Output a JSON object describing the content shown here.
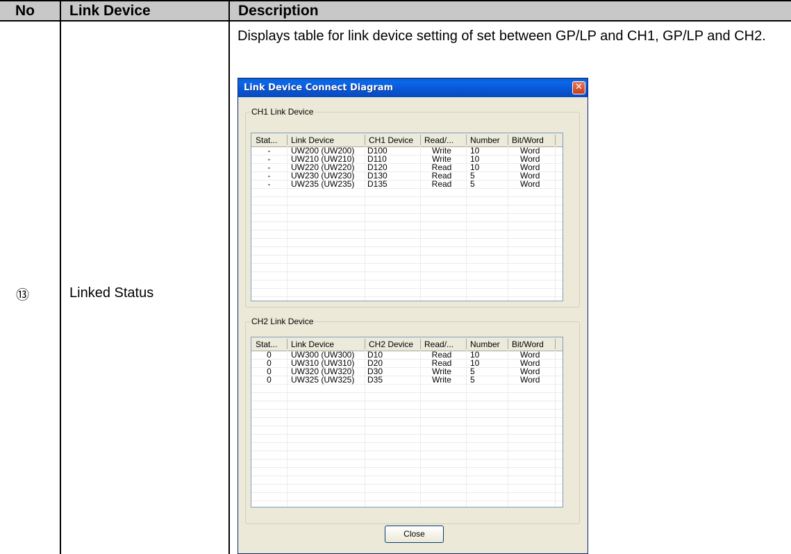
{
  "table": {
    "headers": {
      "no": "No",
      "device": "Link Device",
      "description": "Description"
    },
    "row": {
      "no": "⑬",
      "device": "Linked Status",
      "description": "Displays table for link device setting of set between GP/LP and CH1, GP/LP and CH2."
    }
  },
  "dialog": {
    "title": "Link Device Connect Diagram",
    "close_glyph": "✕",
    "close_label": "Close",
    "ch1": {
      "legend": "CH1 Link Device",
      "columns": [
        "Stat...",
        "Link Device",
        "CH1 Device",
        "Read/...",
        "Number",
        "Bit/Word"
      ],
      "rows": [
        [
          "-",
          "UW200 (UW200)",
          "D100",
          "Write",
          "10",
          "Word"
        ],
        [
          "-",
          "UW210 (UW210)",
          "D110",
          "Write",
          "10",
          "Word"
        ],
        [
          "-",
          "UW220 (UW220)",
          "D120",
          "Read",
          "10",
          "Word"
        ],
        [
          "-",
          "UW230 (UW230)",
          "D130",
          "Read",
          "5",
          "Word"
        ],
        [
          "-",
          "UW235 (UW235)",
          "D135",
          "Read",
          "5",
          "Word"
        ]
      ]
    },
    "ch2": {
      "legend": "CH2 Link Device",
      "columns": [
        "Stat...",
        "Link Device",
        "CH2 Device",
        "Read/...",
        "Number",
        "Bit/Word"
      ],
      "rows": [
        [
          "0",
          "UW300 (UW300)",
          "D10",
          "Read",
          "10",
          "Word"
        ],
        [
          "0",
          "UW310 (UW310)",
          "D20",
          "Read",
          "10",
          "Word"
        ],
        [
          "0",
          "UW320 (UW320)",
          "D30",
          "Write",
          "5",
          "Word"
        ],
        [
          "0",
          "UW325 (UW325)",
          "D35",
          "Write",
          "5",
          "Word"
        ]
      ]
    }
  },
  "colors": {
    "header_bg": "#c8c8c8",
    "titlebar": "#0a5fd8",
    "dialog_bg": "#ece9d8"
  }
}
